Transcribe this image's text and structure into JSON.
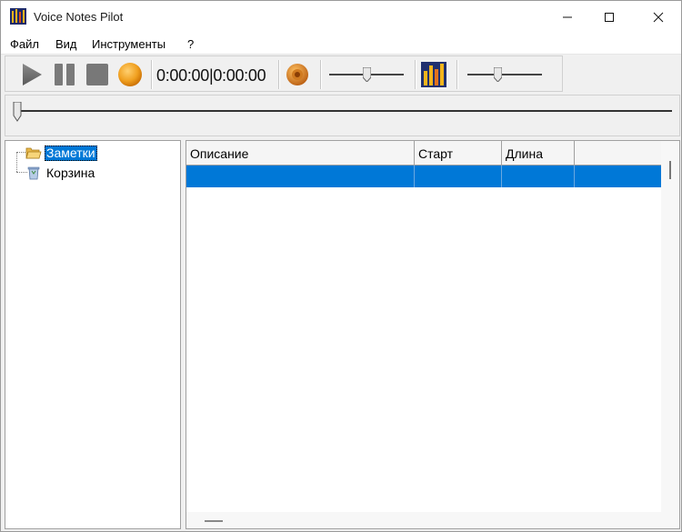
{
  "window": {
    "title": "Voice Notes Pilot"
  },
  "menu": {
    "items": [
      "Файл",
      "Вид",
      "Инструменты",
      "?"
    ]
  },
  "toolbar": {
    "time_display": "0:00:00|0:00:00",
    "icons": [
      "play-icon",
      "pause-icon",
      "stop-icon",
      "record-icon",
      "speaker-icon",
      "equalizer-icon"
    ],
    "volume_level": 0.5,
    "speed_level": 0.4
  },
  "position": {
    "level": 0.0
  },
  "tree": {
    "items": [
      {
        "label": "Заметки",
        "icon": "folder-open-icon",
        "selected": true
      },
      {
        "label": "Корзина",
        "icon": "recycle-bin-icon",
        "selected": false
      }
    ]
  },
  "list": {
    "columns": [
      "Описание",
      "Старт",
      "Длина"
    ],
    "rows": [
      {
        "description": "",
        "start": "",
        "length": "",
        "selected": true
      }
    ]
  },
  "colors": {
    "selection": "#0078d7",
    "accent_orange": "#f0a020"
  }
}
